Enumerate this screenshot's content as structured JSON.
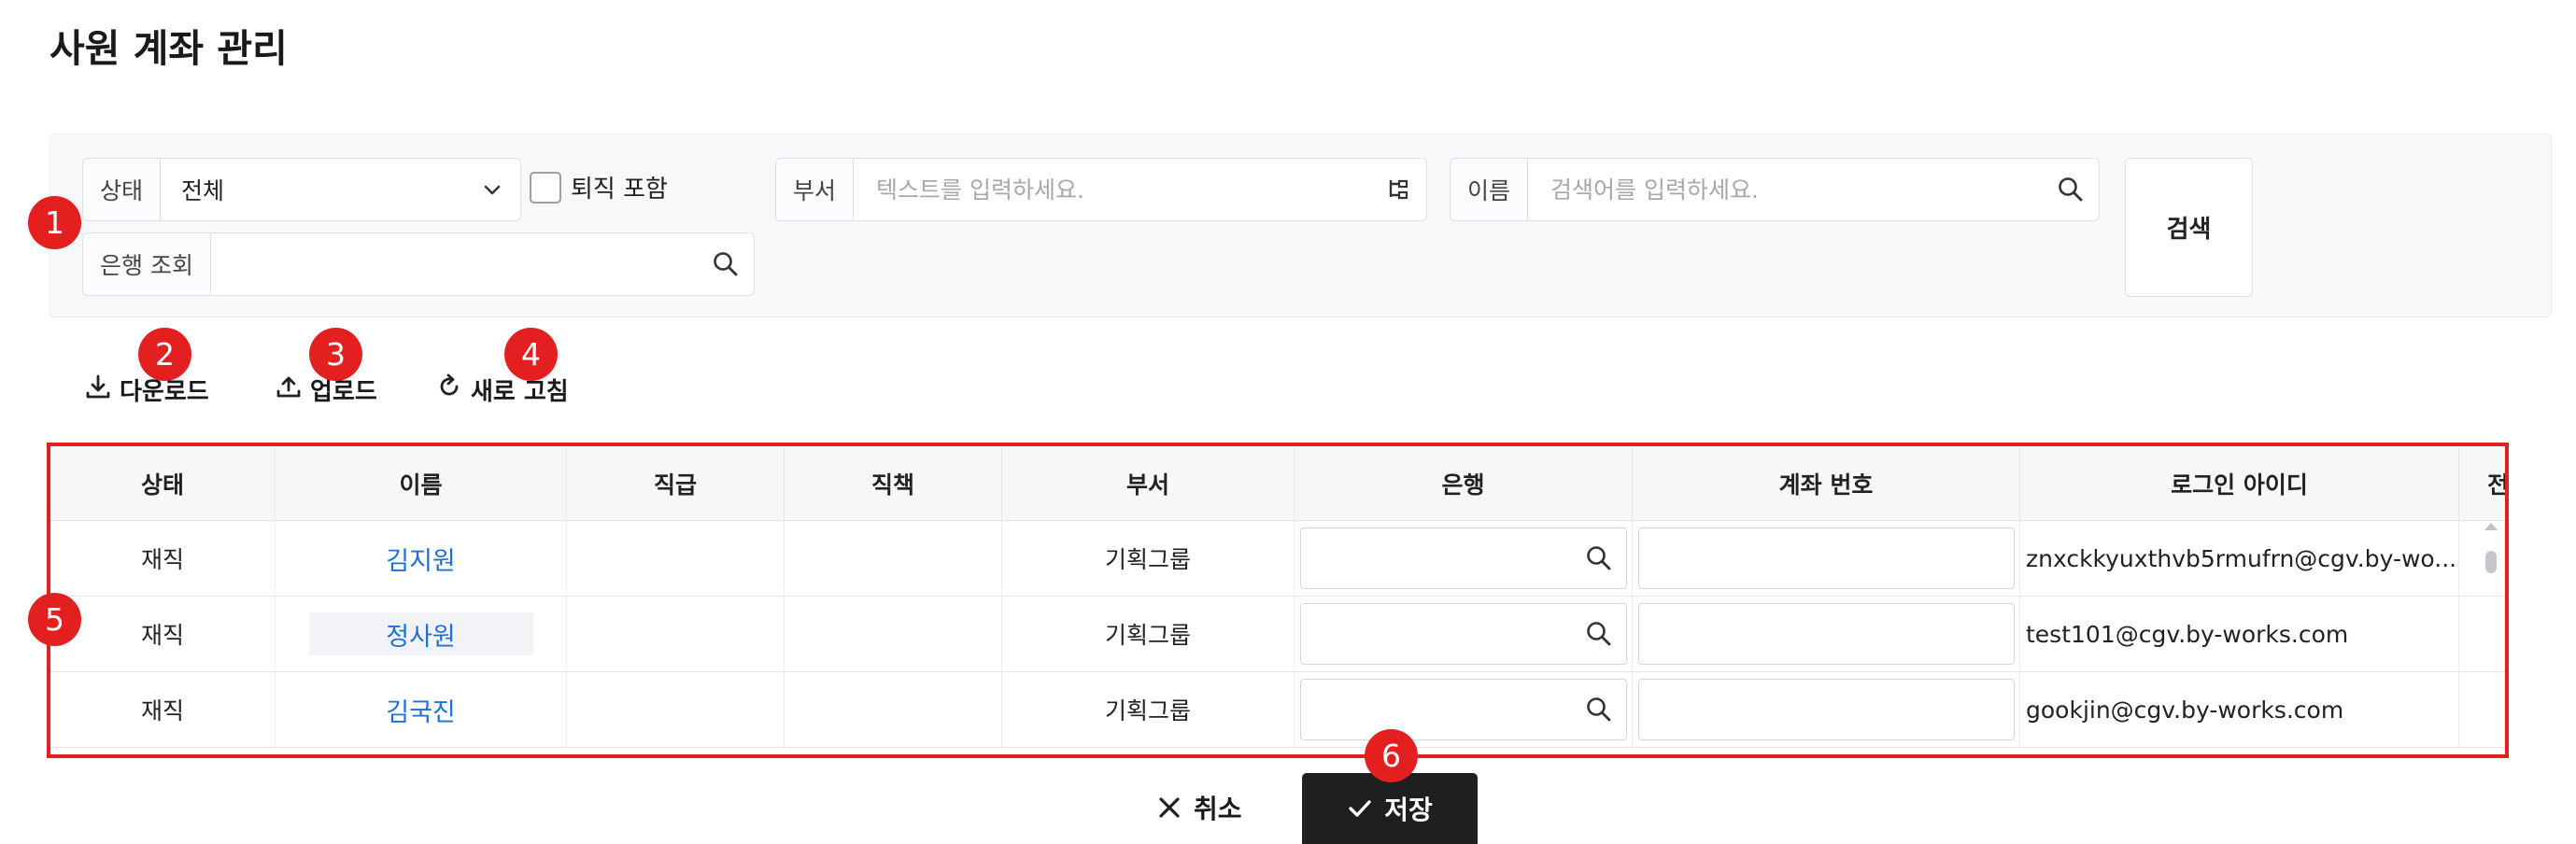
{
  "page": {
    "title": "사원 계좌 관리"
  },
  "filters": {
    "status": {
      "label": "상태",
      "value": "전체"
    },
    "include_retired": {
      "label": "퇴직 포함",
      "checked": false
    },
    "department": {
      "label": "부서",
      "placeholder": "텍스트를 입력하세요."
    },
    "name": {
      "label": "이름",
      "placeholder": "검색어를 입력하세요."
    },
    "bank": {
      "label": "은행 조회",
      "value": ""
    },
    "search_button": "검색"
  },
  "toolbar": {
    "download": "다운로드",
    "upload": "업로드",
    "refresh": "새로 고침"
  },
  "badges": [
    "1",
    "2",
    "3",
    "4",
    "5",
    "6"
  ],
  "grid": {
    "columns": [
      "상태",
      "이름",
      "직급",
      "직책",
      "부서",
      "은행",
      "계좌 번호",
      "로그인 아이디",
      "전화"
    ],
    "rows": [
      {
        "status": "재직",
        "name": "김지원",
        "rank": "",
        "position": "",
        "dept": "기획그룹",
        "bank": "",
        "account": "",
        "login": "znxckkyuxthvb5rmufrn@cgv.by-wo..."
      },
      {
        "status": "재직",
        "name": "정사원",
        "rank": "",
        "position": "",
        "dept": "기획그룹",
        "bank": "",
        "account": "",
        "login": "test101@cgv.by-works.com"
      },
      {
        "status": "재직",
        "name": "김국진",
        "rank": "",
        "position": "",
        "dept": "기획그룹",
        "bank": "",
        "account": "",
        "login": "gookjin@cgv.by-works.com"
      }
    ]
  },
  "actions": {
    "cancel": "취소",
    "save": "저장"
  },
  "colors": {
    "badge": "#e3201f",
    "highlight_border": "#e3201f",
    "link": "#1f6fd6",
    "save_bg": "#1f1f1f"
  },
  "icons": [
    "chevron-down-icon",
    "org-tree-icon",
    "search-icon",
    "download-icon",
    "upload-icon",
    "refresh-icon",
    "close-icon",
    "check-icon"
  ]
}
